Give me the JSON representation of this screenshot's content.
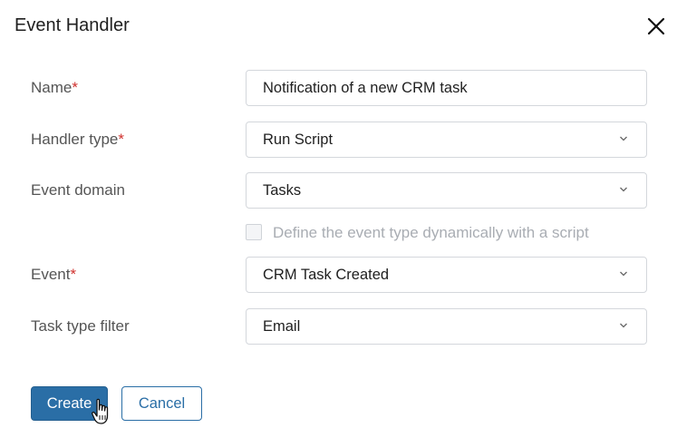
{
  "dialog": {
    "title": "Event Handler",
    "close_icon": "close-icon"
  },
  "fields": {
    "name": {
      "label": "Name",
      "required_mark": "*",
      "value": "Notification of a new CRM task"
    },
    "handler_type": {
      "label": "Handler type",
      "required_mark": "*",
      "value": "Run Script"
    },
    "event_domain": {
      "label": "Event domain",
      "value": "Tasks"
    },
    "dynamic_checkbox": {
      "label": "Define the event type dynamically with a script",
      "checked": false,
      "disabled": true
    },
    "event": {
      "label": "Event",
      "required_mark": "*",
      "value": "CRM Task Created"
    },
    "task_type_filter": {
      "label": "Task type filter",
      "value": "Email"
    }
  },
  "buttons": {
    "create": "Create",
    "cancel": "Cancel"
  },
  "colors": {
    "primary": "#2a6ea6",
    "required": "#d0312d",
    "label": "#555555",
    "disabled_text": "#a9adb3"
  }
}
